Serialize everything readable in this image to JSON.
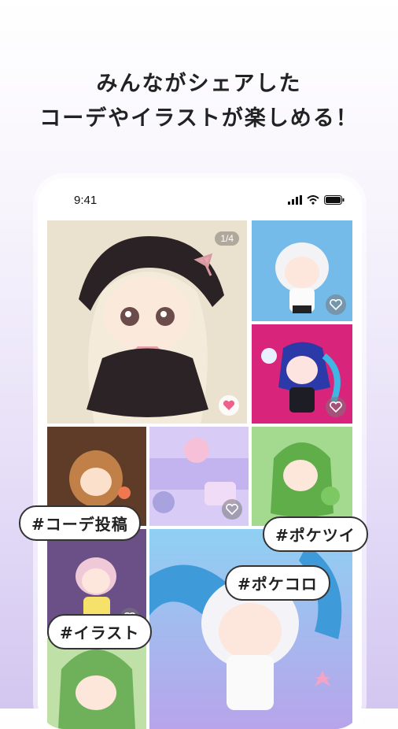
{
  "headline": {
    "line1": "みんながシェアした",
    "line2": "コーデやイラストが楽しめる！"
  },
  "status_bar": {
    "time": "9:41",
    "icons": [
      "signal-icon",
      "wifi-icon",
      "battery-icon"
    ]
  },
  "feed": {
    "main_post_counter": "1/4",
    "tiles": [
      {
        "name": "post-gothic-chibi",
        "liked": true
      },
      {
        "name": "post-sheep-hood",
        "liked": false
      },
      {
        "name": "post-pink-blue-hair",
        "liked": false
      },
      {
        "name": "post-brown-hair",
        "liked": false
      },
      {
        "name": "post-pastel-room",
        "liked": false
      },
      {
        "name": "post-frog-hood",
        "liked": false
      },
      {
        "name": "post-purple-bg",
        "liked": false
      },
      {
        "name": "post-green-hair",
        "liked": false
      },
      {
        "name": "post-white-hood-large",
        "liked": false
      }
    ]
  },
  "tags": {
    "coordinate_post": "#コーデ投稿",
    "pokeotsui": "#ポケツイ",
    "pokekoro": "#ポケコロ",
    "illust": "#イラスト"
  },
  "colors": {
    "accent_pink": "#f0608a",
    "tile_blue": "#6fb7e8",
    "tile_magenta": "#d4207a"
  }
}
